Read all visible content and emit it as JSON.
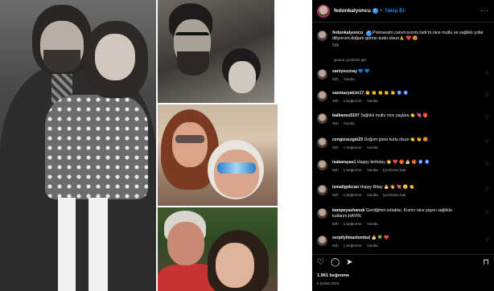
{
  "post": {
    "username": "fedonkalyoncu",
    "verified_mark": "✓",
    "follow_separator": "•",
    "follow_label": "Takip Et",
    "more_label": "···",
    "caption_user": "fedonkalyoncu",
    "caption_text": "Prensesim,canım kızım,cadı'm,nice mutlu ve sağlıklı yıllar diliyorum,doğum günün kutlu olsun🙏 ❤️ 😍",
    "caption_time": "50h",
    "see_translation": "Şunun çevirisini gör"
  },
  "comments": [
    {
      "user": "saniyeoznay",
      "text": "💙 💙",
      "time": "50h",
      "likes": "",
      "reply": "Yanıtla",
      "translate": ""
    },
    {
      "user": "sasmazyalcin17",
      "text": "👏 👏 👏 👏 👏 🧿 🧿",
      "time": "49h",
      "likes": "1 beğenme",
      "reply": "Yanıtla",
      "translate": ""
    },
    {
      "user": "balkanes5107",
      "text": "Sağlıklı mutlu nice yaşlara 👏 💘 🎁",
      "time": "50h",
      "likes": "",
      "reply": "Yanıtla",
      "translate": ""
    },
    {
      "user": "cengizsezgin23",
      "text": "Doğum günü kutlu olsun 👏 👏 😍",
      "time": "50h",
      "likes": "1 beğenme",
      "reply": "Yanıtla",
      "translate": ""
    },
    {
      "user": "isakarayas1",
      "text": "Happy birthday 👏 ❤️ 🎁 🎂 🎁 🧿 🧿",
      "time": "50h",
      "likes": "1 beğenme",
      "reply": "Yanıtla",
      "translate": "Çevirisine bak"
    },
    {
      "user": "ismailgokcan",
      "text": "Happy Bday 🎂 👋 💘 🙂 👏",
      "time": "50h",
      "likes": "1 beğenme",
      "reply": "Yanıtla",
      "translate": "Çevirisine bak"
    },
    {
      "user": "kampeyashanuk",
      "text": "Genliğimin sırtabisi. Kısmrı nice yaşını sağlıkla kutlarım.HAYRL",
      "time": "50h",
      "likes": "1 beğenme",
      "reply": "Yanıtla",
      "translate": ""
    },
    {
      "user": "serpilyilmaztombul",
      "text": "🎂 🍀 ❤️",
      "time": "50h",
      "likes": "1 beğenme",
      "reply": "Yanıtla",
      "translate": ""
    }
  ],
  "actions": {
    "like_icon": "♡",
    "comment_icon": "◯",
    "share_icon": "➤",
    "save_icon": "⊓"
  },
  "likes_count": "1.961 beğenme",
  "post_date": "4 Şubat 2023",
  "icons": {
    "heart": "♡"
  }
}
